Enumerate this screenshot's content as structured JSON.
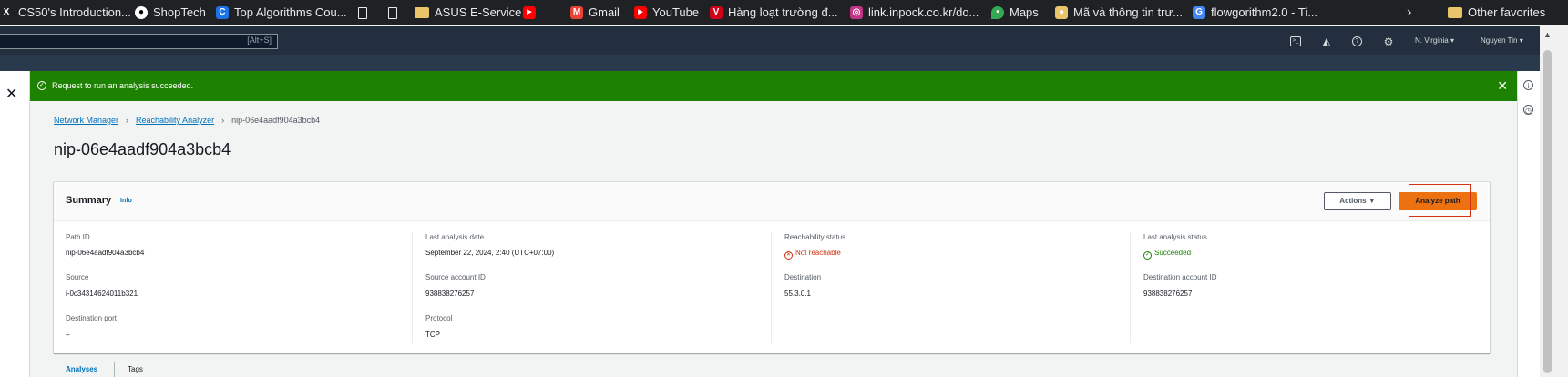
{
  "bookmarks": [
    {
      "label": "CS50's Introduction...",
      "icon": "x-icon",
      "color": "#ffffff"
    },
    {
      "label": "ShopTech",
      "icon": "github-icon",
      "color": "#ffffff"
    },
    {
      "label": "Top Algorithms Cou...",
      "icon": "c-icon",
      "color": "#1a73e8"
    },
    {
      "label": "",
      "icon": "doc-icon"
    },
    {
      "label": "",
      "icon": "doc-icon"
    },
    {
      "label": "ASUS E-Service",
      "icon": "folder-icon"
    },
    {
      "label": "",
      "icon": "youtube-icon",
      "color": "#ff0000"
    },
    {
      "label": "Gmail",
      "icon": "gmail-icon",
      "color": "#ea4335"
    },
    {
      "label": "YouTube",
      "icon": "youtube-icon",
      "color": "#ff0000"
    },
    {
      "label": "Hàng loạt trường đ...",
      "icon": "v-icon",
      "color": "#d0021b"
    },
    {
      "label": "link.inpock.co.kr/do...",
      "icon": "instagram-icon",
      "color": "#c13584"
    },
    {
      "label": "Maps",
      "icon": "maps-icon",
      "color": "#34a853"
    },
    {
      "label": "Mã và thông tin trư...",
      "icon": "folder-icon"
    },
    {
      "label": "flowgorithm2.0 - Ti...",
      "icon": "google-icon",
      "color": "#4285f4"
    },
    {
      "label": "Other favorites",
      "icon": "folder-icon"
    }
  ],
  "topnav": {
    "search_shortcut": "[Alt+S]",
    "region": "N. Virginia",
    "user": "Nguyen Tin"
  },
  "flash": {
    "message": "Request to run an analysis succeeded."
  },
  "breadcrumb": {
    "items": [
      "Network Manager",
      "Reachability Analyzer"
    ],
    "current": "nip-06e4aadf904a3bcb4"
  },
  "page_title": "nip-06e4aadf904a3bcb4",
  "summary": {
    "title": "Summary",
    "info_link": "Info",
    "actions_label": "Actions",
    "analyze_label": "Analyze path",
    "fields": {
      "path_id": {
        "label": "Path ID",
        "value": "nip-06e4aadf904a3bcb4"
      },
      "last_analysis_date": {
        "label": "Last analysis date",
        "value": "September 22, 2024, 2:40 (UTC+07:00)"
      },
      "reachability_status": {
        "label": "Reachability status",
        "value": "Not reachable"
      },
      "last_analysis_status": {
        "label": "Last analysis status",
        "value": "Succeeded"
      },
      "source": {
        "label": "Source",
        "value": "i-0c34314624011b321"
      },
      "source_account_id": {
        "label": "Source account ID",
        "value": "938838276257"
      },
      "destination": {
        "label": "Destination",
        "value": "55.3.0.1"
      },
      "destination_account_id": {
        "label": "Destination account ID",
        "value": "938838276257"
      },
      "destination_port": {
        "label": "Destination port",
        "value": "–"
      },
      "protocol": {
        "label": "Protocol",
        "value": "TCP"
      }
    }
  },
  "tabs": [
    "Analyses",
    "Tags"
  ]
}
